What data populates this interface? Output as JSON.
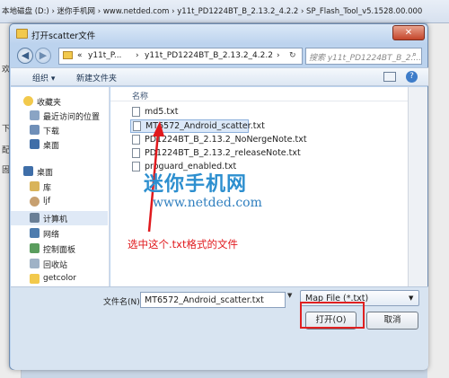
{
  "background_window": {
    "path": "本地磁盘 (D:) › 迷你手机网 › www.netded.com › y11t_PD1224BT_B_2.13.2_4.2.2 › SP_Flash_Tool_v5.1528.00.000",
    "left_fragments": [
      "欢",
      "下",
      "配",
      "固"
    ]
  },
  "dialog": {
    "title": "打开scatter文件",
    "close_label": "✕",
    "address": {
      "segments": [
        "«",
        "y11t_P...",
        "›",
        "y11t_PD1224BT_B_2.13.2_4.2.2",
        "›"
      ]
    },
    "search_placeholder": "搜索 y11t_PD1224BT_B_2....",
    "toolbar": {
      "organize": "组织 ▾",
      "new_folder": "新建文件夹"
    },
    "nav": {
      "favorites": "收藏夹",
      "recent": "最近访问的位置",
      "downloads": "下载",
      "desktop_fav": "桌面",
      "desktop": "桌面",
      "libraries": "库",
      "user": "ljf",
      "computer": "计算机",
      "network": "网络",
      "control_panel": "控制面板",
      "recycle_bin": "回收站",
      "getcolor": "getcolor"
    },
    "column_header": "名称",
    "files": [
      "md5.txt",
      "MT6572_Android_scatter.txt",
      "PD1224BT_B_2.13.2_NoNergeNote.txt",
      "PD1224BT_B_2.13.2_releaseNote.txt",
      "proguard_enabled.txt"
    ],
    "filename_label": "文件名(N):",
    "filename_value": "MT6572_Android_scatter.txt",
    "filter_value": "Map File (*.txt)",
    "open_label": "打开(O)",
    "cancel_label": "取消"
  },
  "annotation": "选中这个.txt格式的文件",
  "watermark": {
    "title": "迷你手机网",
    "url": "www.netded.com"
  },
  "colors": {
    "annotation_red": "#e0191d",
    "watermark_blue": "#2d8fcf"
  }
}
